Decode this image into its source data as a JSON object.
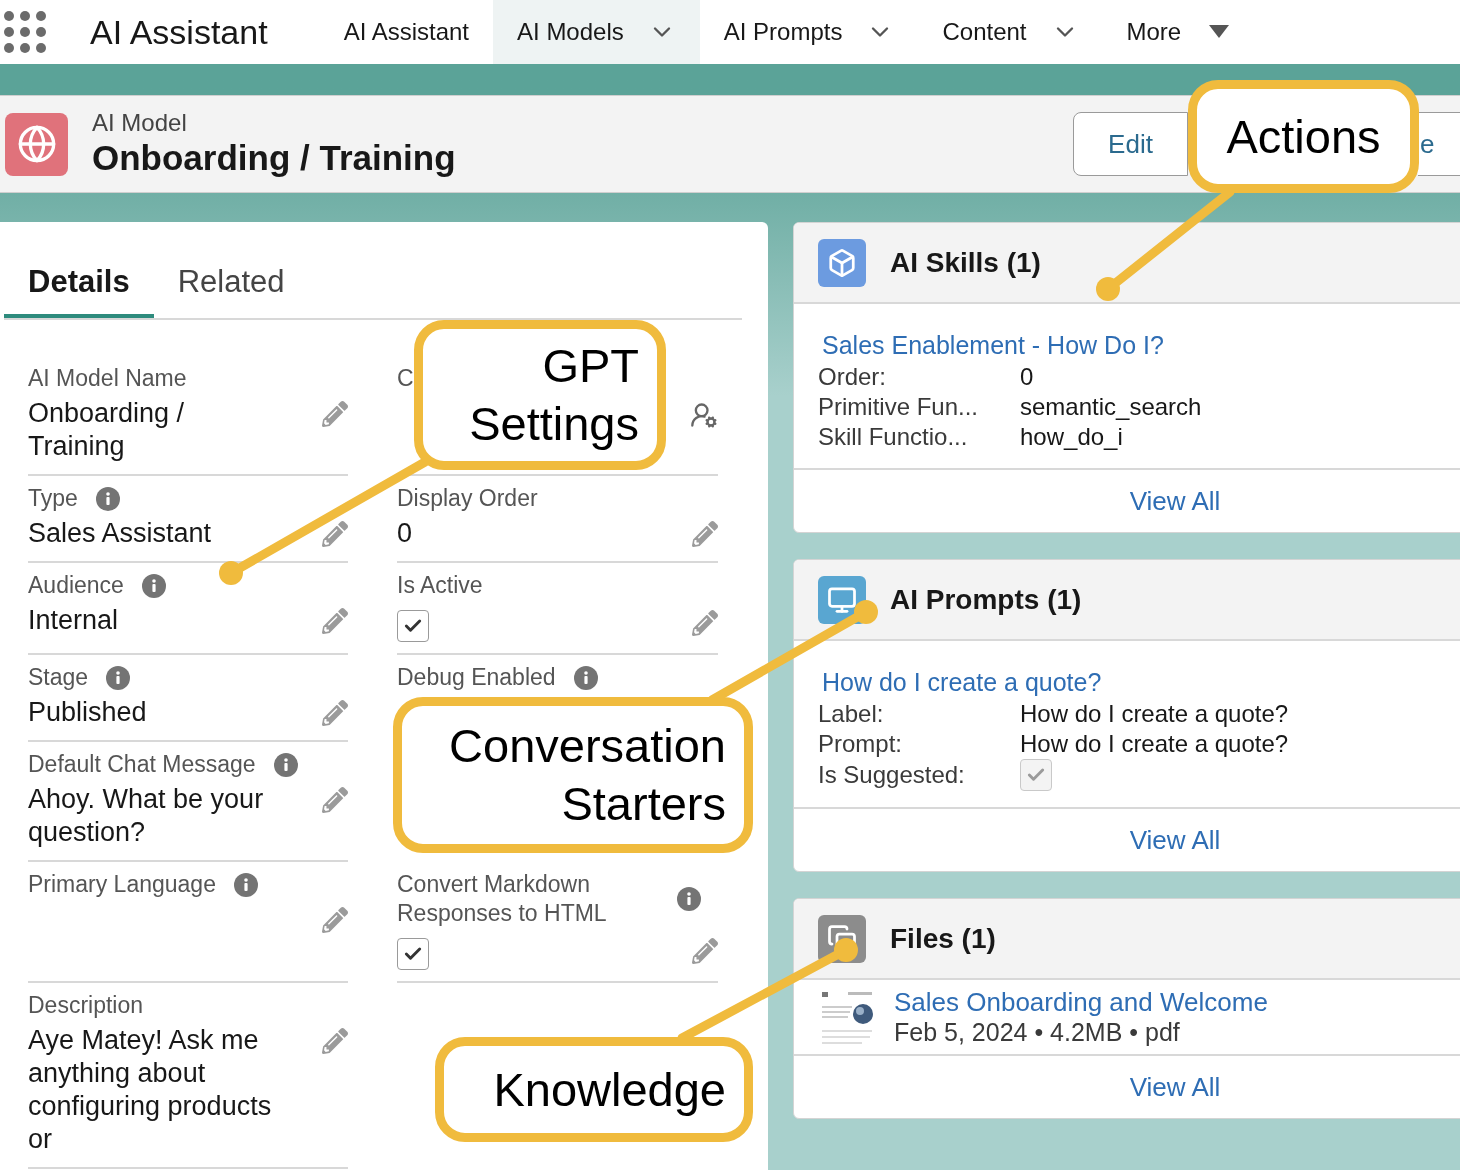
{
  "app": {
    "title": "AI Assistant"
  },
  "nav": [
    {
      "label": "AI Assistant",
      "selected": false,
      "kind": "plain"
    },
    {
      "label": "AI Models",
      "selected": true,
      "kind": "chevron"
    },
    {
      "label": "AI Prompts",
      "selected": false,
      "kind": "chevron"
    },
    {
      "label": "Content",
      "selected": false,
      "kind": "chevron"
    },
    {
      "label": "More",
      "selected": false,
      "kind": "triangle"
    }
  ],
  "record": {
    "object": "AI Model",
    "title": "Onboarding / Training",
    "actions": [
      "Edit",
      "e"
    ]
  },
  "tabs": [
    {
      "label": "Details",
      "selected": true
    },
    {
      "label": "Related",
      "selected": false
    }
  ],
  "fields": [
    {
      "left": {
        "label": "AI Model Name",
        "info": false,
        "kind": "text",
        "value": "Onboarding / Training",
        "editable": true
      },
      "right": {
        "label": "C",
        "info": false,
        "kind": "owner",
        "editable": false
      }
    },
    {
      "left": {
        "label": "Type",
        "info": true,
        "kind": "text",
        "value": "Sales Assistant",
        "editable": true
      },
      "right": {
        "label": "Display Order",
        "info": false,
        "kind": "text",
        "value": "0",
        "editable": true
      }
    },
    {
      "left": {
        "label": "Audience",
        "info": true,
        "kind": "text",
        "value": "Internal",
        "editable": true
      },
      "right": {
        "label": "Is Active",
        "info": false,
        "kind": "checkbox",
        "checked": true,
        "editable": true
      }
    },
    {
      "left": {
        "label": "Stage",
        "info": true,
        "kind": "text",
        "value": "Published",
        "editable": true
      },
      "right": {
        "label": "Debug Enabled",
        "info": true,
        "kind": "blank",
        "editable": false
      }
    },
    {
      "left": {
        "label": "Default Chat Message",
        "info": true,
        "kind": "text",
        "value": "Ahoy. What be your question?",
        "editable": true
      }
    },
    {
      "left": {
        "label": "Primary Language",
        "info": true,
        "kind": "blank",
        "editable": true
      },
      "right": {
        "label": "Convert Markdown Responses to HTML",
        "info": true,
        "kind": "checkbox",
        "checked": true,
        "editable": true
      }
    },
    {
      "left": {
        "label": "Description",
        "info": false,
        "kind": "text",
        "value": "Aye Matey! Ask me anything about configuring products or",
        "editable": true
      }
    }
  ],
  "cards": [
    {
      "kind": "skills",
      "color": "#6c9be0",
      "title": "AI Skills (1)",
      "link": "Sales Enablement - How Do I?",
      "rows": [
        {
          "label": "Order:",
          "kind": "text",
          "value": "0"
        },
        {
          "label": "Primitive Fun...",
          "kind": "text",
          "value": "semantic_search"
        },
        {
          "label": "Skill Functio...",
          "kind": "text",
          "value": "how_do_i"
        }
      ],
      "footer": "View All"
    },
    {
      "kind": "prompts",
      "color": "#59a6d1",
      "title": "AI Prompts (1)",
      "link": "How do I create a quote?",
      "rows": [
        {
          "label": "Label:",
          "kind": "text",
          "value": "How do I create a quote?"
        },
        {
          "label": "Prompt:",
          "kind": "text",
          "value": "How do I create a quote?"
        },
        {
          "label": "Is Suggested:",
          "kind": "checkbox",
          "checked": true
        }
      ],
      "footer": "View All"
    },
    {
      "kind": "files",
      "color": "#8c8c8c",
      "title": "Files (1)",
      "files": [
        {
          "name": "Sales Onboarding and Welcome",
          "meta": "Feb 5, 2024 • 4.2MB • pdf"
        }
      ],
      "footer": "View All"
    }
  ],
  "annotations": [
    {
      "text": "Actions"
    },
    {
      "text": "GPT Settings"
    },
    {
      "text": "Conversation Starters"
    },
    {
      "text": "Knowledge"
    }
  ]
}
